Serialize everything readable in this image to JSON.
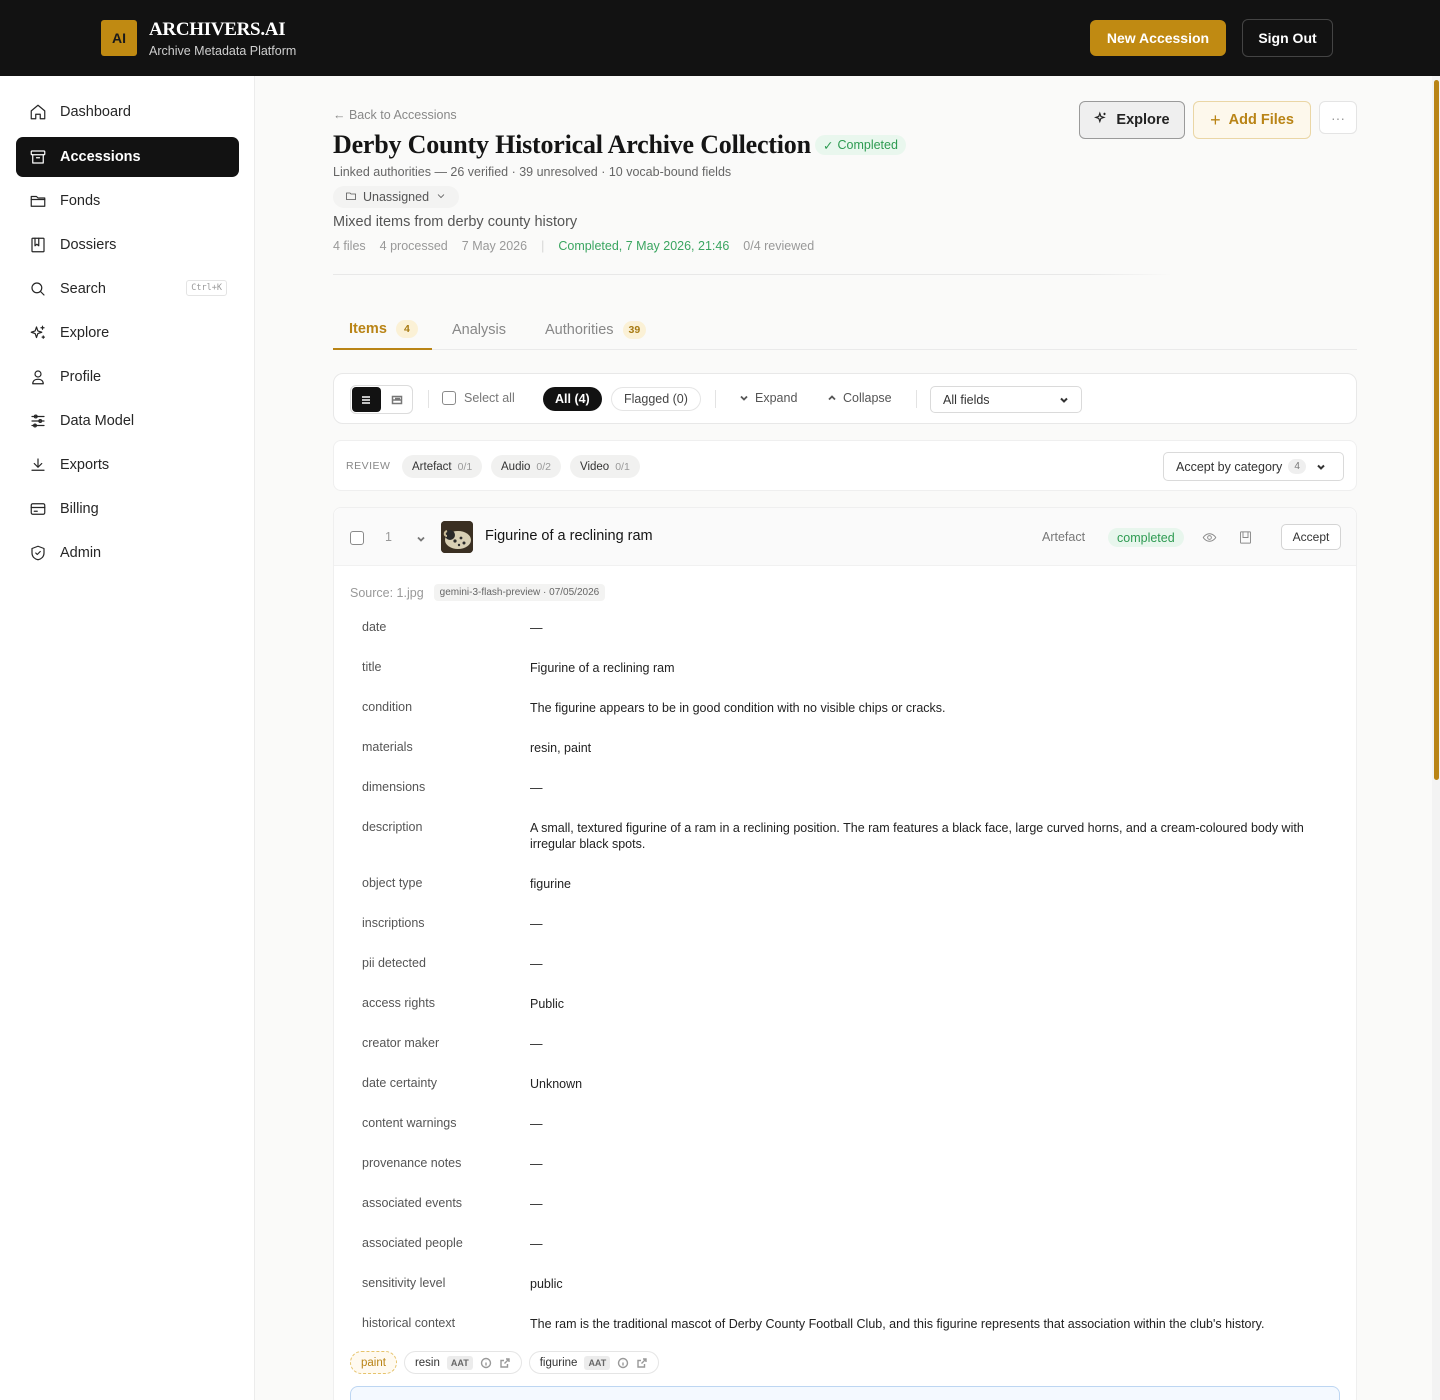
{
  "header": {
    "logo_text": "AI",
    "brand_name": "ARCHIVERS.AI",
    "brand_sub": "Archive Metadata Platform",
    "new_accession_label": "New Accession",
    "sign_out_label": "Sign Out",
    "accent_color": "#c08a12"
  },
  "sidebar": {
    "items": [
      {
        "label": "Dashboard",
        "icon": "home-icon"
      },
      {
        "label": "Accessions",
        "icon": "archive-box-icon",
        "active": true
      },
      {
        "label": "Fonds",
        "icon": "folder-icon"
      },
      {
        "label": "Dossiers",
        "icon": "book-icon"
      },
      {
        "label": "Search",
        "icon": "search-icon",
        "shortcut": "Ctrl+K"
      },
      {
        "label": "Explore",
        "icon": "sparkles-icon"
      },
      {
        "label": "Profile",
        "icon": "user-icon"
      },
      {
        "label": "Data Model",
        "icon": "sliders-icon"
      },
      {
        "label": "Exports",
        "icon": "download-icon"
      },
      {
        "label": "Billing",
        "icon": "credit-card-icon"
      },
      {
        "label": "Admin",
        "icon": "shield-check-icon"
      }
    ]
  },
  "page": {
    "back_link": "← Back to Accessions",
    "title": "Derby County Historical Archive Collection",
    "status": "Completed",
    "linked_authorities": "Linked authorities — 26 verified · 39 unresolved · 10 vocab-bound fields",
    "assignment": "Unassigned",
    "description": "Mixed items from derby county history",
    "meta": {
      "files": "4 files",
      "processed": "4 processed",
      "date": "7 May 2026",
      "completed": "Completed, 7 May 2026, 21:46",
      "reviewed": "0/4 reviewed"
    },
    "actions": {
      "explore": "Explore",
      "add_files": "Add Files",
      "more": "···"
    }
  },
  "tabs": [
    {
      "label": "Items",
      "count": "4",
      "active": true
    },
    {
      "label": "Analysis"
    },
    {
      "label": "Authorities",
      "count": "39"
    }
  ],
  "toolbar": {
    "select_all": "Select all",
    "filter_all": "All (4)",
    "filter_flagged": "Flagged (0)",
    "expand": "Expand",
    "collapse": "Collapse",
    "fields_select": "All fields"
  },
  "review": {
    "label": "REVIEW",
    "categories": [
      {
        "name": "Artefact",
        "count": "0/1"
      },
      {
        "name": "Audio",
        "count": "0/2"
      },
      {
        "name": "Video",
        "count": "0/1"
      }
    ],
    "accept_by_category": "Accept by category",
    "accept_count": "4"
  },
  "item": {
    "index": "1",
    "title": "Figurine of a reclining ram",
    "type": "Artefact",
    "status": "completed",
    "accept_label": "Accept",
    "source": "Source: 1.jpg",
    "model": "gemini-3-flash-preview · 07/05/2026",
    "fields": [
      {
        "key": "date",
        "value": "—"
      },
      {
        "key": "title",
        "value": "Figurine of a reclining ram"
      },
      {
        "key": "condition",
        "value": "The figurine appears to be in good condition with no visible chips or cracks."
      },
      {
        "key": "materials",
        "value": "resin, paint"
      },
      {
        "key": "dimensions",
        "value": "—"
      },
      {
        "key": "description",
        "value": "A small, textured figurine of a ram in a reclining position. The ram features a black face, large curved horns, and a cream-coloured body with irregular black spots."
      },
      {
        "key": "object type",
        "value": "figurine"
      },
      {
        "key": "inscriptions",
        "value": "—"
      },
      {
        "key": "pii detected",
        "value": "—"
      },
      {
        "key": "access rights",
        "value": "Public"
      },
      {
        "key": "creator maker",
        "value": "—"
      },
      {
        "key": "date certainty",
        "value": "Unknown"
      },
      {
        "key": "content warnings",
        "value": "—"
      },
      {
        "key": "provenance notes",
        "value": "—"
      },
      {
        "key": "associated events",
        "value": "—"
      },
      {
        "key": "associated people",
        "value": "—"
      },
      {
        "key": "sensitivity level",
        "value": "public"
      },
      {
        "key": "historical context",
        "value": "The ram is the traditional mascot of Derby County Football Club, and this figurine represents that association within the club's history."
      }
    ],
    "tags": [
      {
        "label": "paint",
        "unresolved": true
      },
      {
        "label": "resin",
        "vocab": "AAT"
      },
      {
        "label": "figurine",
        "vocab": "AAT"
      }
    ]
  }
}
